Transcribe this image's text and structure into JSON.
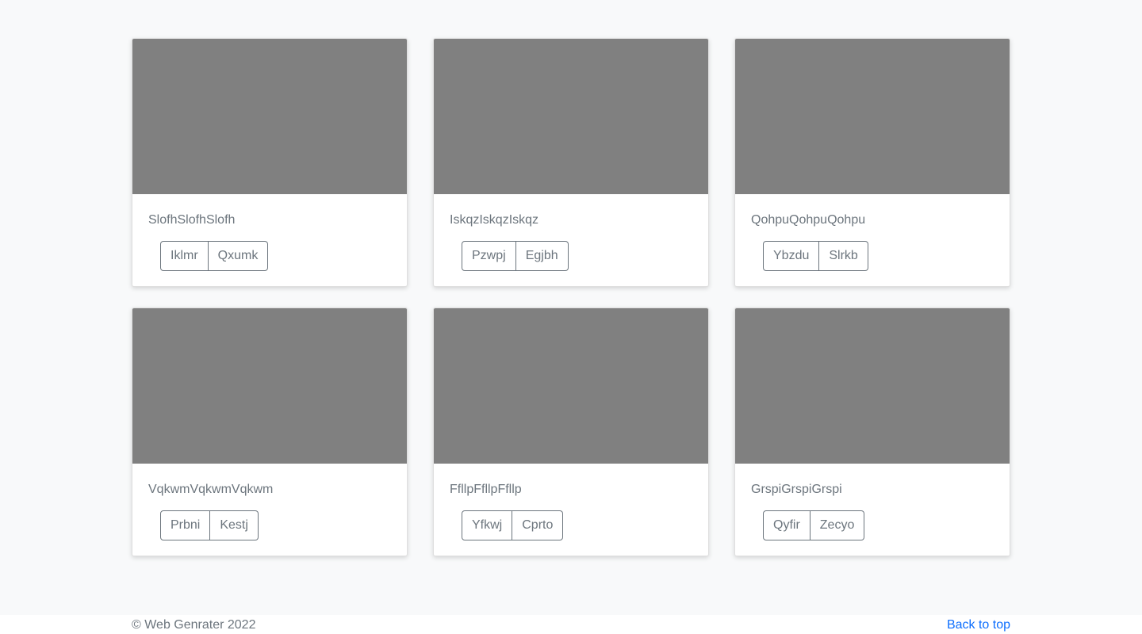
{
  "cards": [
    {
      "title": "SlofhSlofhSlofh",
      "buttons": [
        "Iklmr",
        "Qxumk"
      ]
    },
    {
      "title": "IskqzIskqzIskqz",
      "buttons": [
        "Pzwpj",
        "Egjbh"
      ]
    },
    {
      "title": "QohpuQohpuQohpu",
      "buttons": [
        "Ybzdu",
        "Slrkb"
      ]
    },
    {
      "title": "VqkwmVqkwmVqkwm",
      "buttons": [
        "Prbni",
        "Kestj"
      ]
    },
    {
      "title": "FfllpFfllpFfllp",
      "buttons": [
        "Yfkwj",
        "Cprto"
      ]
    },
    {
      "title": "GrspiGrspiGrspi",
      "buttons": [
        "Qyfir",
        "Zecyo"
      ]
    }
  ],
  "footer": {
    "copyright": "© Web Genrater 2022",
    "back_to_top": "Back to top"
  },
  "colors": {
    "thumbnail": "#808080",
    "background": "#f8f9fa",
    "link": "#0d6efd",
    "text": "#6c757d"
  }
}
